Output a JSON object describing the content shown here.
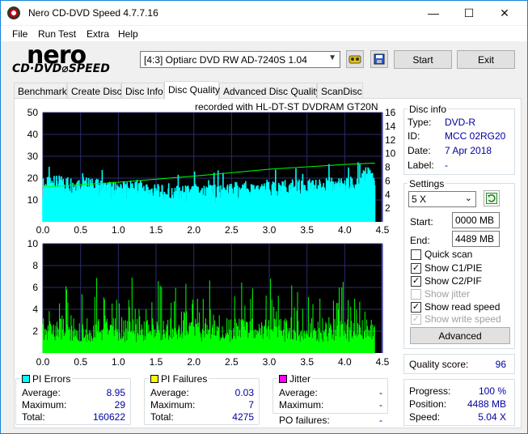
{
  "window": {
    "title": "Nero CD-DVD Speed 4.7.7.16",
    "minimize": "—",
    "maximize": "☐",
    "close": "✕"
  },
  "menu": [
    "File",
    "Run Test",
    "Extra",
    "Help"
  ],
  "logo": {
    "brand": "nero",
    "product": "CD·DVD⌀SPEED"
  },
  "toolbar": {
    "drive": "[4:3]  Optiarc DVD RW AD-7240S 1.04",
    "start_label": "Start",
    "exit_label": "Exit",
    "icons": [
      "eject-icon",
      "save-icon"
    ]
  },
  "tabs": [
    "Benchmark",
    "Create Disc",
    "Disc Info",
    "Disc Quality",
    "Advanced Disc Quality",
    "ScanDisc"
  ],
  "active_tab": "Disc Quality",
  "chart_caption": "recorded with HL-DT-ST DVDRAM GT20N",
  "disc_info": {
    "title": "Disc info",
    "rows": [
      {
        "label": "Type:",
        "value": "DVD-R"
      },
      {
        "label": "ID:",
        "value": "MCC 02RG20"
      },
      {
        "label": "Date:",
        "value": "7 Apr 2018"
      },
      {
        "label": "Label:",
        "value": "-"
      }
    ]
  },
  "settings": {
    "title": "Settings",
    "speed": "5 X",
    "start_label": "Start:",
    "start_value": "0000 MB",
    "end_label": "End:",
    "end_value": "4489 MB",
    "checks": [
      {
        "label": "Quick scan",
        "checked": false,
        "disabled": false
      },
      {
        "label": "Show C1/PIE",
        "checked": true,
        "disabled": false
      },
      {
        "label": "Show C2/PIF",
        "checked": true,
        "disabled": false
      },
      {
        "label": "Show jitter",
        "checked": false,
        "disabled": true
      },
      {
        "label": "Show read speed",
        "checked": true,
        "disabled": false
      },
      {
        "label": "Show write speed",
        "checked": true,
        "disabled": true
      }
    ],
    "advanced_label": "Advanced"
  },
  "quality": {
    "label": "Quality score:",
    "value": "96"
  },
  "progress": {
    "rows": [
      {
        "label": "Progress:",
        "value": "100 %"
      },
      {
        "label": "Position:",
        "value": "4488 MB"
      },
      {
        "label": "Speed:",
        "value": "5.04 X"
      }
    ]
  },
  "pi_errors": {
    "title": "PI Errors",
    "color": "#00ffff",
    "rows": [
      {
        "label": "Average:",
        "value": "8.95"
      },
      {
        "label": "Maximum:",
        "value": "29"
      },
      {
        "label": "Total:",
        "value": "160622"
      }
    ]
  },
  "pi_failures": {
    "title": "PI Failures",
    "color": "#ffff00",
    "rows": [
      {
        "label": "Average:",
        "value": "0.03"
      },
      {
        "label": "Maximum:",
        "value": "7"
      },
      {
        "label": "Total:",
        "value": "4275"
      }
    ]
  },
  "jitter": {
    "title": "Jitter",
    "color": "#ff00ff",
    "rows": [
      {
        "label": "Average:",
        "value": "-"
      },
      {
        "label": "Maximum:",
        "value": "-"
      }
    ],
    "po_label": "PO failures:",
    "po_value": "-"
  },
  "chart_data": [
    {
      "type": "area",
      "x_ticks": [
        "0.0",
        "0.5",
        "1.0",
        "1.5",
        "2.0",
        "2.5",
        "3.0",
        "3.5",
        "4.0",
        "4.5"
      ],
      "xlim": [
        0,
        4.5
      ],
      "y_left_ticks": [
        "10",
        "20",
        "30",
        "40",
        "50"
      ],
      "ylim_left": [
        0,
        50
      ],
      "y_right_ticks": [
        "2",
        "4",
        "6",
        "8",
        "10",
        "12",
        "14",
        "16"
      ],
      "ylim_right": [
        0,
        16
      ],
      "grid": true,
      "series": [
        {
          "color": "#00ffff",
          "x": [
            0.0,
            0.25,
            0.5,
            0.75,
            1.0,
            1.25,
            1.5,
            1.75,
            2.0,
            2.25,
            2.5,
            2.75,
            3.0,
            3.25,
            3.5,
            3.75,
            4.0,
            4.2,
            4.3,
            4.4
          ],
          "values": [
            16,
            17,
            17,
            15,
            14,
            15,
            13,
            12,
            13,
            13,
            14,
            13,
            14,
            15,
            15,
            16,
            16,
            17,
            22,
            19
          ]
        },
        {
          "color": "#00ff00",
          "x": [
            0.0,
            1.0,
            2.0,
            3.0,
            4.0,
            4.4
          ],
          "values": [
            5.1,
            5.8,
            6.7,
            7.7,
            8.4,
            8.6
          ]
        }
      ]
    },
    {
      "type": "bar",
      "x_ticks": [
        "0.0",
        "0.5",
        "1.0",
        "1.5",
        "2.0",
        "2.5",
        "3.0",
        "3.5",
        "4.0",
        "4.5"
      ],
      "xlim": [
        0,
        4.5
      ],
      "y_ticks": [
        "2",
        "4",
        "6",
        "8",
        "10"
      ],
      "ylim": [
        0,
        10
      ],
      "grid": true,
      "series": [
        {
          "color": "#00ff00",
          "x": [
            0.0,
            0.5,
            1.0,
            1.5,
            2.0,
            2.5,
            3.0,
            3.5,
            4.0,
            4.4
          ],
          "values": [
            2,
            2,
            2,
            2,
            2,
            2,
            2,
            2,
            2,
            2
          ]
        }
      ]
    }
  ]
}
